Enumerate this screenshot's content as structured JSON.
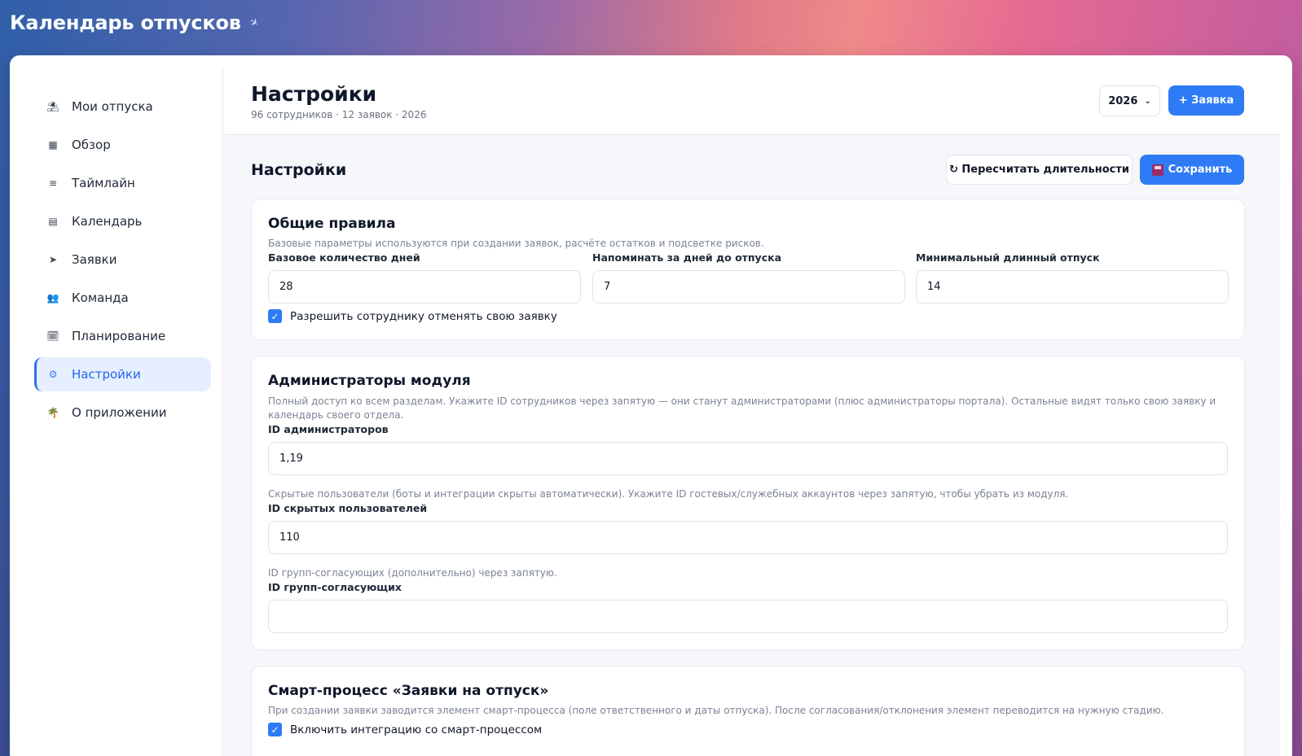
{
  "app": {
    "title": "Календарь отпусков",
    "pin_icon": "pin-icon"
  },
  "sidebar": {
    "items": [
      {
        "label": "Мои отпуска",
        "icon": "umbrella-icon",
        "glyph": "⛱"
      },
      {
        "label": "Обзор",
        "icon": "grid-icon",
        "glyph": "▦"
      },
      {
        "label": "Таймлайн",
        "icon": "list-icon",
        "glyph": "≡"
      },
      {
        "label": "Календарь",
        "icon": "calendar-icon",
        "glyph": "▤"
      },
      {
        "label": "Заявки",
        "icon": "send-icon",
        "glyph": "➤"
      },
      {
        "label": "Команда",
        "icon": "team-icon",
        "glyph": "👥"
      },
      {
        "label": "Планирование",
        "icon": "planning-icon",
        "glyph": "🗓"
      },
      {
        "label": "Настройки",
        "icon": "gear-icon",
        "glyph": "⚙"
      },
      {
        "label": "О приложении",
        "icon": "palm-icon",
        "glyph": "🌴"
      }
    ],
    "active_index": 7
  },
  "header": {
    "title": "Настройки",
    "subtitle": "96 сотрудников · 12 заявок · 2026",
    "year_selected": "2026",
    "new_request_label": "+ Заявка"
  },
  "settings": {
    "title": "Настройки",
    "recalc_label": "↻ Пересчитать длительности",
    "save_label": "Сохранить"
  },
  "general": {
    "title": "Общие правила",
    "description": "Базовые параметры используются при создании заявок, расчёте остатков и подсветке рисков.",
    "base_days_label": "Базовое количество дней",
    "base_days_value": "28",
    "remind_label": "Напоминать за дней до отпуска",
    "remind_value": "7",
    "min_long_label": "Минимальный длинный отпуск",
    "min_long_value": "14",
    "allow_cancel_label": "Разрешить сотруднику отменять свою заявку",
    "allow_cancel_checked": true
  },
  "admins": {
    "title": "Администраторы модуля",
    "description": "Полный доступ ко всем разделам. Укажите ID сотрудников через запятую — они станут администраторами (плюс администраторы портала). Остальные видят только свою заявку и календарь своего отдела.",
    "admin_ids_label": "ID администраторов",
    "admin_ids_value": "1,19",
    "hidden_desc": "Скрытые пользователи (боты и интеграции скрыты автоматически). Укажите ID гостевых/служебных аккаунтов через запятую, чтобы убрать из модуля.",
    "hidden_ids_label": "ID скрытых пользователей",
    "hidden_ids_value": "110",
    "approver_desc": "ID групп-согласующих (дополнительно) через запятую.",
    "approver_ids_label": "ID групп-согласующих",
    "approver_ids_value": ""
  },
  "smart": {
    "title": "Смарт-процесс «Заявки на отпуск»",
    "description": "При создании заявки заводится элемент смарт-процесса (поле ответственного и даты отпуска). После согласования/отклонения элемент переводится на нужную стадию.",
    "enable_label": "Включить интеграцию со смарт-процессом",
    "enable_checked": true
  }
}
